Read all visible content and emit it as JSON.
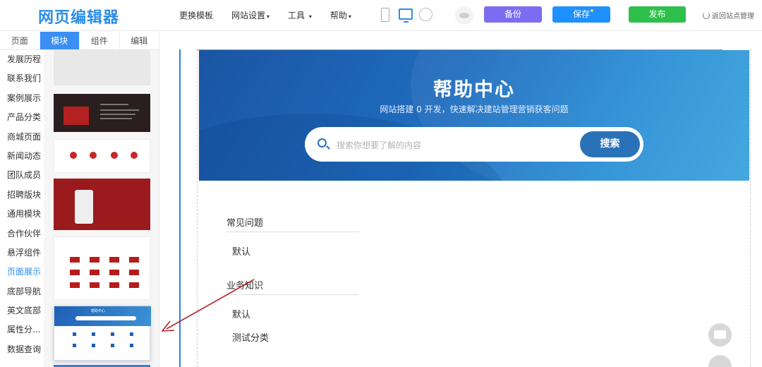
{
  "header": {
    "logo": "网页编辑器",
    "menu": [
      {
        "label": "更换模板",
        "caret": ""
      },
      {
        "label": "网站设置",
        "caret": "▾"
      },
      {
        "label": "工具",
        "caret": "▾"
      },
      {
        "label": "帮助",
        "caret": "▾"
      }
    ],
    "buttons": {
      "backup": "备份",
      "save": "保存",
      "publish": "发布"
    },
    "back_link": "返回站点管理",
    "colors": {
      "backup": "#7b6cf2",
      "save": "#1e90ff",
      "publish": "#2fbf4b",
      "accent": "#2b8ee8"
    }
  },
  "sidebar": {
    "tabs": [
      "页面",
      "模块",
      "组件",
      "编辑"
    ],
    "active_tab": "模块",
    "categories": [
      "发展历程",
      "联系我们",
      "案例展示",
      "产品分类",
      "商城页面",
      "新闻动态",
      "团队成员",
      "招聘版块",
      "通用模块",
      "合作伙伴",
      "悬浮组件",
      "页面展示",
      "底部导航",
      "英文底部",
      "属性分...",
      "数据查询"
    ],
    "active_category": "页面展示",
    "thumb_help_title": "帮助中心"
  },
  "canvas": {
    "hero": {
      "title": "帮助中心",
      "subtitle": "网站搭建 0 开发，快速解决建站管理营销获客问题",
      "search_placeholder": "搜索你想要了解的内容",
      "search_button": "搜索"
    },
    "sections": [
      {
        "heading": "常见问题",
        "items": [
          "默认"
        ]
      },
      {
        "heading": "业务知识",
        "items": [
          "默认",
          "测试分类"
        ]
      }
    ]
  }
}
